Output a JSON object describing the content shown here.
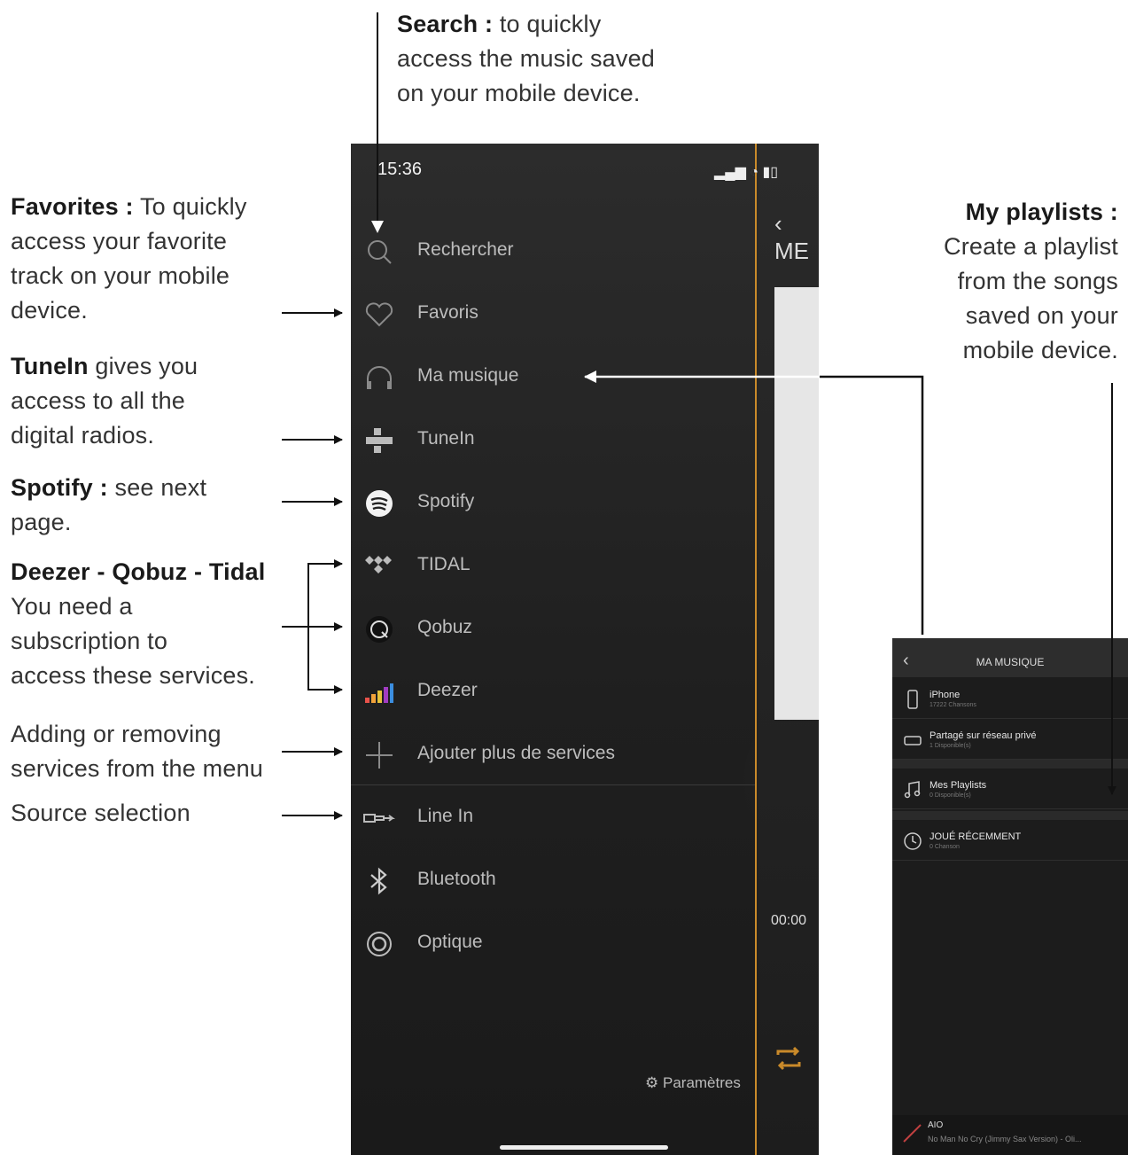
{
  "annotations": {
    "search": {
      "title": "Search :",
      "lines": [
        "to quickly",
        "access the music saved",
        "on your mobile device."
      ]
    },
    "favorites": {
      "title": "Favorites :",
      "lines": [
        "To quickly",
        "access your favorite",
        "track on your mobile",
        "device."
      ]
    },
    "tunein": {
      "title": "TuneIn",
      "lines": [
        "gives you",
        "access to all the",
        "digital radios."
      ]
    },
    "spotify": {
      "title": "Spotify :",
      "lines": [
        "see next",
        "page."
      ]
    },
    "dqt": {
      "title": "Deezer - Qobuz - Tidal",
      "lines": [
        "You need a",
        "subscription to",
        "access these services."
      ]
    },
    "adding": {
      "lines": [
        "Adding or removing",
        "services from the menu"
      ]
    },
    "source": {
      "lines": [
        "Source selection"
      ]
    },
    "playlists": {
      "title": "My playlists :",
      "lines": [
        "Create a playlist",
        "from the songs",
        "saved on your",
        "mobile device."
      ]
    }
  },
  "phone": {
    "status_time": "15:36",
    "status_icons": "▂▄▆  ◔  ▮▯",
    "back_label": "‹ ME",
    "time_label": "00:00",
    "settings_label": "Paramètres",
    "menu": [
      {
        "label": "Rechercher",
        "icon": "search-icon"
      },
      {
        "label": "Favoris",
        "icon": "heart-icon"
      },
      {
        "label": "Ma musique",
        "icon": "headphones-icon"
      },
      {
        "label": "TuneIn",
        "icon": "tunein-icon"
      },
      {
        "label": "Spotify",
        "icon": "spotify-icon"
      },
      {
        "label": "TIDAL",
        "icon": "tidal-icon"
      },
      {
        "label": "Qobuz",
        "icon": "qobuz-icon"
      },
      {
        "label": "Deezer",
        "icon": "deezer-icon"
      },
      {
        "label": "Ajouter plus de services",
        "icon": "plus-icon"
      },
      {
        "label": "Line In",
        "icon": "line-in-icon"
      },
      {
        "label": "Bluetooth",
        "icon": "bluetooth-icon"
      },
      {
        "label": "Optique",
        "icon": "optical-icon"
      }
    ]
  },
  "phone2": {
    "back": "‹",
    "title": "MA MUSIQUE",
    "rows": [
      {
        "title": "iPhone",
        "sub": "17222 Chansons",
        "icon": "phone-icon"
      },
      {
        "title": "Partagé sur réseau privé",
        "sub": "1 Disponible(s)",
        "icon": "network-drive-icon"
      },
      {
        "title": "Mes Playlists",
        "sub": "0 Disponible(s)",
        "icon": "music-note-icon"
      },
      {
        "title": "JOUÉ RÉCEMMENT",
        "sub": "0 Chanson",
        "icon": "clock-icon"
      }
    ],
    "now_playing": {
      "title": "AIO",
      "sub": "No Man No Cry (Jimmy Sax Version) - Oli..."
    }
  },
  "colors": {
    "accent": "#c98a2a",
    "phone_bg": "#222222",
    "menu_text": "#bdbdbd"
  }
}
